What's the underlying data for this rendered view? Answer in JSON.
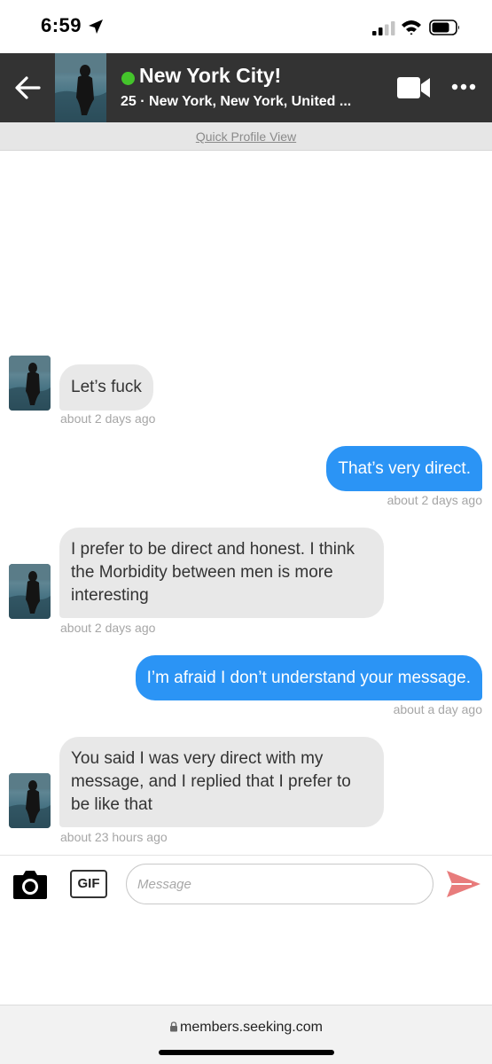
{
  "status_bar": {
    "time": "6:59"
  },
  "header": {
    "name": "New York City!",
    "subtitle": "25 · New York, New York, United ...",
    "online_color": "#44c42b",
    "icons": [
      "back-arrow-icon",
      "video-camera-icon",
      "more-options-icon"
    ]
  },
  "quick_profile": {
    "label": "Quick Profile View"
  },
  "messages": [
    {
      "direction": "incoming",
      "text": "Let’s fuck",
      "time": "about 2 days ago"
    },
    {
      "direction": "outgoing",
      "text": "That’s very direct.",
      "time": "about 2 days ago"
    },
    {
      "direction": "incoming",
      "text": "I prefer to be direct and honest. I think the Morbidity between men is more interesting",
      "time": "about 2 days ago"
    },
    {
      "direction": "outgoing",
      "text": "I’m afraid I don’t understand your message.",
      "time": "about a day ago"
    },
    {
      "direction": "incoming",
      "text": "You said I was very direct with my message, and I replied that I prefer to be like that",
      "time": "about 23 hours ago"
    }
  ],
  "composer": {
    "gif_label": "GIF",
    "placeholder": "Message",
    "value": ""
  },
  "browser": {
    "url": "members.seeking.com"
  },
  "colors": {
    "header_bg": "#333333",
    "outgoing_bubble": "#2b94f5",
    "incoming_bubble": "#e8e8e8",
    "send_icon": "#e87c7c"
  }
}
